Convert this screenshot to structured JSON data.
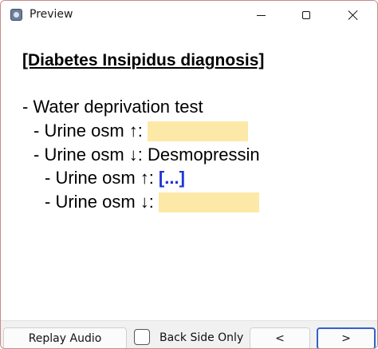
{
  "window": {
    "title": "Preview",
    "icon": "anki-app-icon"
  },
  "card": {
    "heading": "[Diabetes Insipidus diagnosis]",
    "lines": [
      {
        "text": "- Water deprivation test"
      },
      {
        "text": "- Urine osm ↑:",
        "cloze": "hidden"
      },
      {
        "text": "- Urine osm ↓: Desmopressin"
      },
      {
        "text": "- Urine osm ↑:",
        "cloze_active": "[...]"
      },
      {
        "text": "- Urine osm ↓:",
        "cloze": "hidden"
      }
    ]
  },
  "bottom": {
    "replay_label": "Replay Audio",
    "back_side_only_label": "Back Side Only",
    "back_side_only_checked": false,
    "prev_label": "<",
    "next_label": ">"
  },
  "colors": {
    "cloze_highlight": "#fde9a7",
    "cloze_active_text": "#1d35d6",
    "focus_border": "#2f63c7"
  }
}
